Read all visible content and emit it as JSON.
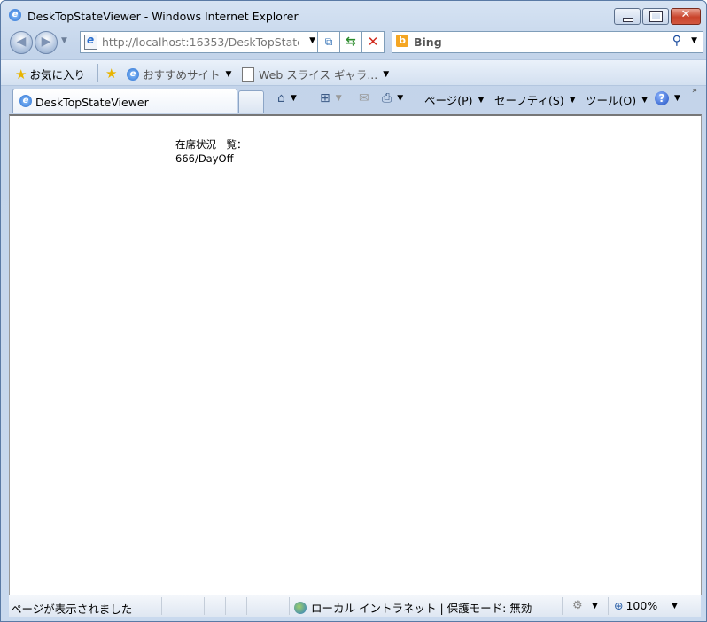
{
  "window": {
    "title": "DeskTopStateViewer - Windows Internet Explorer"
  },
  "address_bar": {
    "url": "http://localhost:16353/DeskTopStateV"
  },
  "search": {
    "engine": "Bing"
  },
  "favorites_bar": {
    "favorites_label": "お気に入り",
    "suggested_sites_label": "おすすめサイト",
    "web_slice_label": "Web スライス ギャラ..."
  },
  "tab": {
    "label": "DeskTopStateViewer"
  },
  "command_bar": {
    "page_label": "ページ(P)",
    "safety_label": "セーフティ(S)",
    "tools_label": "ツール(O)"
  },
  "content": {
    "heading": "在席状況一覧：",
    "entry": "666/DayOff"
  },
  "status_bar": {
    "status_text": "ページが表示されました",
    "zone_text": "ローカル イントラネット | 保護モード: 無効",
    "zoom": "100%"
  },
  "colors": {
    "close_button": "#c9442c",
    "accent": "#2a6fcf",
    "bing": "#f5a623"
  }
}
